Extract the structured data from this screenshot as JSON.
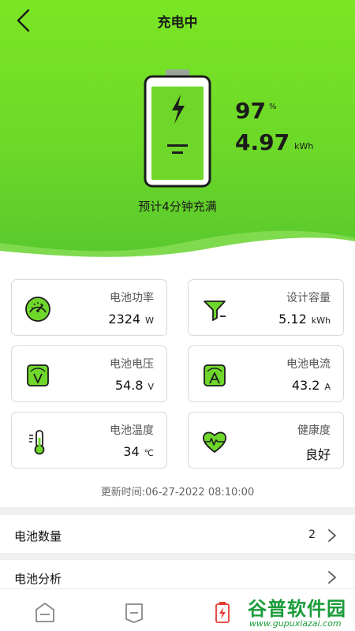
{
  "header": {
    "title": "充电中"
  },
  "battery": {
    "percent": "97",
    "percent_unit": "%",
    "energy": "4.97",
    "energy_unit": "kWh",
    "eta_text": "预计4分钟充满",
    "level_fraction": 0.97
  },
  "cards": [
    {
      "label": "电池功率",
      "value": "2324",
      "unit": "W",
      "icon": "speedometer-icon"
    },
    {
      "label": "设计容量",
      "value": "5.12",
      "unit": "kWh",
      "icon": "funnel-icon"
    },
    {
      "label": "电池电压",
      "value": "54.8",
      "unit": "V",
      "icon": "voltage-icon"
    },
    {
      "label": "电池电流",
      "value": "43.2",
      "unit": "A",
      "icon": "current-icon"
    },
    {
      "label": "电池温度",
      "value": "34",
      "unit": "℃",
      "icon": "thermometer-icon"
    },
    {
      "label": "健康度",
      "value": "良好",
      "unit": "",
      "icon": "heart-pulse-icon"
    }
  ],
  "updated": "更新时间:06-27-2022 08:10:00",
  "rows": [
    {
      "label": "电池数量",
      "value": "2"
    },
    {
      "label": "电池分析",
      "value": ""
    }
  ],
  "tabs": [
    {
      "icon": "home-icon"
    },
    {
      "icon": "device-icon"
    },
    {
      "icon": "battery-charging-icon"
    }
  ],
  "watermark": {
    "main": "谷普软件园",
    "url": "www.gupuxiazai.com"
  },
  "colors": {
    "accent": "#6dd928",
    "battery_fill": "#6fd72a",
    "active_tab": "#e53935"
  }
}
